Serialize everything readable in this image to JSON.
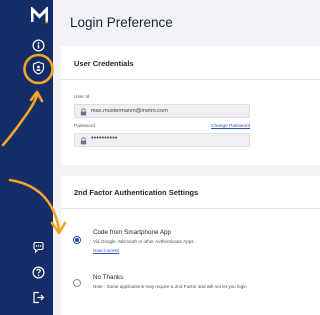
{
  "app": {
    "logo_letter": "M"
  },
  "sidebar": {
    "items": [
      {
        "icon": "info-icon"
      },
      {
        "icon": "shield-icon",
        "highlighted": true
      },
      {
        "icon": "chat-icon"
      },
      {
        "icon": "help-icon"
      },
      {
        "icon": "logout-icon"
      }
    ]
  },
  "page": {
    "title": "Login Preference"
  },
  "credentials": {
    "title": "User Credentials",
    "user_id_label": "User Id",
    "user_id_value": "max.mustermanm@metro.com",
    "password_label": "Password",
    "password_value": "••••••••••",
    "change_password_label": "Change Password"
  },
  "two_factor": {
    "title": "2nd Factor Authentication Settings",
    "options": [
      {
        "title": "Code from Smartphone App",
        "description": "Via Google, Microsoft or other Authenticator Apps",
        "link": "How it works",
        "selected": true
      },
      {
        "title": "No Thanks",
        "description": "Note : Some applications may require a 2nd Factor and will not let you login",
        "selected": false
      }
    ]
  },
  "colors": {
    "sidebar": "#142d69",
    "accent": "#2a4cb3",
    "annotation": "#f5a623",
    "background": "#f2f3f6"
  }
}
